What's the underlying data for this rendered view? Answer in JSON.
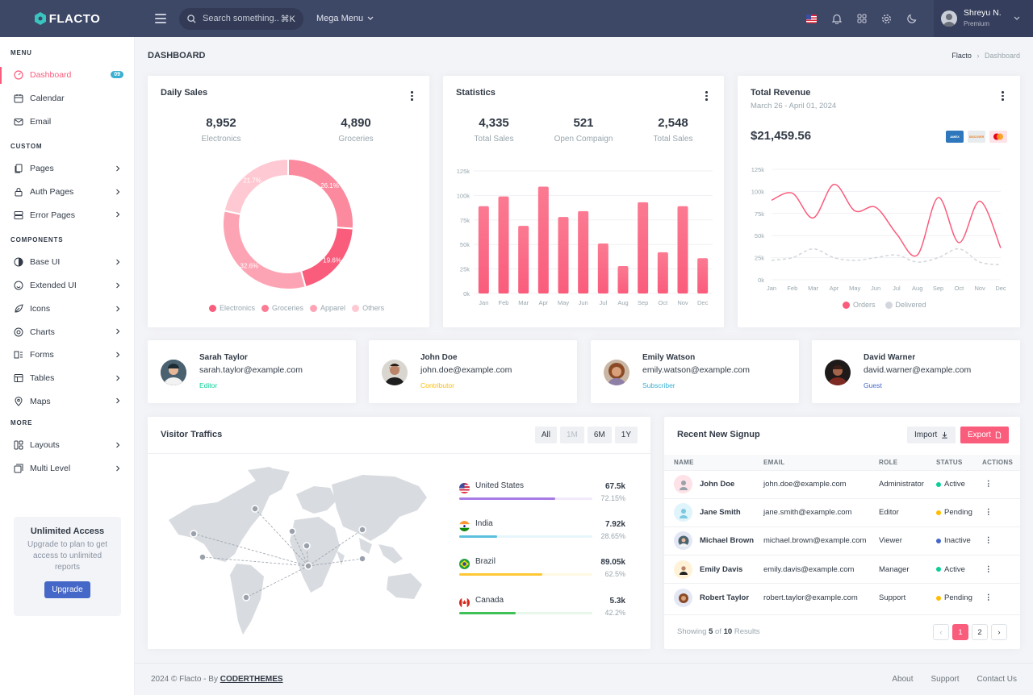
{
  "app": {
    "name": "FLACTO"
  },
  "header": {
    "search_placeholder": "Search something..",
    "search_shortcut": "⌘K",
    "mega_menu": "Mega Menu",
    "user": {
      "name": "Shreyu N.",
      "role": "Premium"
    },
    "icons": [
      "us-flag-icon",
      "bell-icon",
      "apps-icon",
      "gear-icon",
      "moon-icon"
    ]
  },
  "sidebar": {
    "sections": {
      "menu": "MENU",
      "custom": "CUSTOM",
      "components": "COMPONENTS",
      "more": "MORE"
    },
    "items": [
      {
        "label": "Dashboard",
        "badge": "09"
      },
      {
        "label": "Calendar"
      },
      {
        "label": "Email"
      },
      {
        "label": "Pages"
      },
      {
        "label": "Auth Pages"
      },
      {
        "label": "Error Pages"
      },
      {
        "label": "Base UI"
      },
      {
        "label": "Extended UI"
      },
      {
        "label": "Icons"
      },
      {
        "label": "Charts"
      },
      {
        "label": "Forms"
      },
      {
        "label": "Tables"
      },
      {
        "label": "Maps"
      },
      {
        "label": "Layouts"
      },
      {
        "label": "Multi Level"
      }
    ],
    "promo": {
      "title": "Unlimited Access",
      "text": "Upgrade to plan to get access to unlimited reports",
      "button": "Upgrade"
    }
  },
  "page": {
    "title": "DASHBOARD",
    "breadcrumb": [
      "Flacto",
      "Dashboard"
    ]
  },
  "daily_sales": {
    "title": "Daily Sales",
    "stats": [
      {
        "value": "8,952",
        "label": "Electronics"
      },
      {
        "value": "4,890",
        "label": "Groceries"
      }
    ]
  },
  "statistics": {
    "title": "Statistics",
    "stats": [
      {
        "value": "4,335",
        "label": "Total Sales"
      },
      {
        "value": "521",
        "label": "Open Compaign"
      },
      {
        "value": "2,548",
        "label": "Total Sales"
      }
    ]
  },
  "revenue": {
    "title": "Total Revenue",
    "range": "March 26 - April 01, 2024",
    "amount": "$21,459.56",
    "cards": [
      "AMEX",
      "DISCOVER",
      "mastercard"
    ]
  },
  "chart_data": [
    {
      "type": "pie",
      "categories": [
        "Electronics",
        "Groceries",
        "Apparel",
        "Others"
      ],
      "values": [
        26.1,
        19.6,
        32.6,
        21.7
      ],
      "value_labels": [
        "26.1%",
        "19.6%",
        "32.6%",
        "21.7%"
      ],
      "colors": [
        "#fc8a9e",
        "#fa5c7c",
        "#fda4b4",
        "#fec9d2"
      ]
    },
    {
      "type": "bar",
      "categories": [
        "Jan",
        "Feb",
        "Mar",
        "Apr",
        "May",
        "Jun",
        "Jul",
        "Aug",
        "Sep",
        "Oct",
        "Nov",
        "Dec"
      ],
      "values": [
        89000,
        99000,
        69000,
        109000,
        78000,
        84000,
        51000,
        28000,
        93000,
        42000,
        89000,
        36000
      ],
      "ylim": [
        0,
        125000
      ],
      "ytick_labels": [
        "0k",
        "25k",
        "50k",
        "75k",
        "100k",
        "125k"
      ],
      "grid": true
    },
    {
      "type": "line",
      "categories": [
        "Jan",
        "Feb",
        "Mar",
        "Apr",
        "May",
        "Jun",
        "Jul",
        "Aug",
        "Sep",
        "Oct",
        "Nov",
        "Dec"
      ],
      "series": [
        {
          "name": "Orders",
          "values": [
            90000,
            98000,
            70000,
            108000,
            78000,
            82000,
            52000,
            28000,
            93000,
            42000,
            89000,
            36000
          ],
          "color": "#fa5c7c"
        },
        {
          "name": "Delivered",
          "values": [
            22000,
            25000,
            35000,
            25000,
            22000,
            25000,
            28000,
            20000,
            25000,
            35000,
            20000,
            17000
          ],
          "color": "#d3d6dc"
        }
      ],
      "ylim": [
        0,
        125000
      ],
      "ytick_labels": [
        "0k",
        "25k",
        "50k",
        "75k",
        "100k",
        "125k"
      ],
      "grid": true,
      "legend": "bottom"
    }
  ],
  "users": [
    {
      "name": "Sarah Taylor",
      "email": "sarah.taylor@example.com",
      "role": "Editor",
      "role_color": "#0acf97"
    },
    {
      "name": "John Doe",
      "email": "john.doe@example.com",
      "role": "Contributor",
      "role_color": "#ffbc00"
    },
    {
      "name": "Emily Watson",
      "email": "emily.watson@example.com",
      "role": "Subscriber",
      "role_color": "#39afd1"
    },
    {
      "name": "David Warner",
      "email": "david.warner@example.com",
      "role": "Guest",
      "role_color": "#4567c7"
    }
  ],
  "traffic": {
    "title": "Visitor Traffics",
    "filters": [
      "All",
      "1M",
      "6M",
      "1Y"
    ],
    "countries": [
      {
        "name": "United States",
        "value": "67.5k",
        "percent": "72.15%",
        "fill": 0.7215,
        "color": "#a77be6"
      },
      {
        "name": "India",
        "value": "7.92k",
        "percent": "28.65%",
        "fill": 0.2865,
        "color": "#5bc0de"
      },
      {
        "name": "Brazil",
        "value": "89.05k",
        "percent": "62.5%",
        "fill": 0.625,
        "color": "#ffc734"
      },
      {
        "name": "Canada",
        "value": "5.3k",
        "percent": "42.2%",
        "fill": 0.422,
        "color": "#3ec156"
      }
    ]
  },
  "signup": {
    "title": "Recent New Signup",
    "import": "Import",
    "export": "Export",
    "columns": [
      "NAME",
      "EMAIL",
      "ROLE",
      "STATUS",
      "ACTIONS"
    ],
    "rows": [
      {
        "name": "John Doe",
        "email": "john.doe@example.com",
        "role": "Administrator",
        "status": "Active",
        "status_color": "#0acf97",
        "avatar_bg": "#fde2e7"
      },
      {
        "name": "Jane Smith",
        "email": "jane.smith@example.com",
        "role": "Editor",
        "status": "Pending",
        "status_color": "#ffbc00",
        "avatar_bg": "#dff4fb"
      },
      {
        "name": "Michael Brown",
        "email": "michael.brown@example.com",
        "role": "Viewer",
        "status": "Inactive",
        "status_color": "#4567c7",
        "avatar_bg": "#e3e7f4"
      },
      {
        "name": "Emily Davis",
        "email": "emily.davis@example.com",
        "role": "Manager",
        "status": "Active",
        "status_color": "#0acf97",
        "avatar_bg": "#fff2d6"
      },
      {
        "name": "Robert Taylor",
        "email": "robert.taylor@example.com",
        "role": "Support",
        "status": "Pending",
        "status_color": "#ffbc00",
        "avatar_bg": "#e3e7f4"
      }
    ],
    "showing_prefix": "Showing",
    "showing_count": "5",
    "showing_of": "of",
    "showing_total": "10",
    "showing_suffix": "Results",
    "pages": [
      "1",
      "2"
    ]
  },
  "footer": {
    "copyright": "2024 © Flacto - By",
    "brand": "CODERTHEMES",
    "links": [
      "About",
      "Support",
      "Contact Us"
    ]
  }
}
